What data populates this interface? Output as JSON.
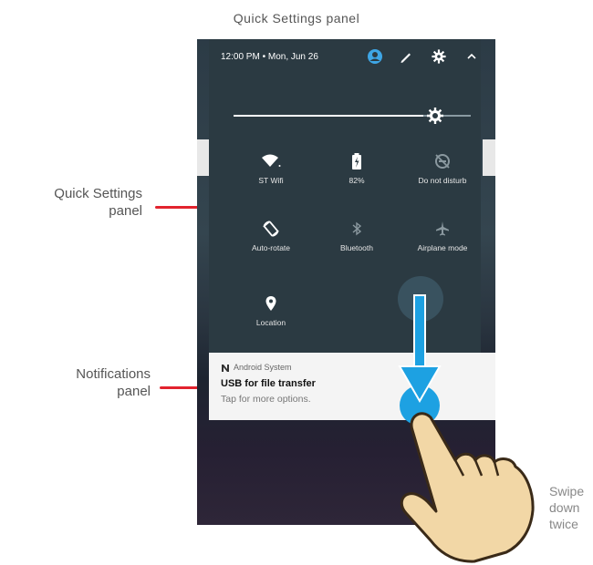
{
  "caption_top": "Quick Settings panel",
  "labels": {
    "quick_settings_line1": "Quick Settings",
    "quick_settings_line2": "panel",
    "notifications_line1": "Notifications",
    "notifications_line2": "panel",
    "swipe_line1": "Swipe",
    "swipe_line2": "down",
    "swipe_line3": "twice"
  },
  "status_bar": {
    "time_date": "12:00 PM • Mon, Jun 26",
    "icons": [
      "account-icon",
      "edit-icon",
      "gear-icon",
      "chevron-up-icon"
    ]
  },
  "brightness": {
    "level": 0.8
  },
  "tiles": [
    {
      "label": "ST Wifi",
      "icon": "wifi-icon"
    },
    {
      "label": "82%",
      "icon": "battery-icon"
    },
    {
      "label": "Do not disturb",
      "icon": "do-not-disturb-icon"
    },
    {
      "label": "Auto-rotate",
      "icon": "auto-rotate-icon"
    },
    {
      "label": "Bluetooth",
      "icon": "bluetooth-icon"
    },
    {
      "label": "Airplane mode",
      "icon": "airplane-icon"
    },
    {
      "label": "Location",
      "icon": "location-icon"
    }
  ],
  "notification": {
    "app": "Android System",
    "title": "USB for file transfer",
    "body": "Tap for more options."
  },
  "colors": {
    "accent_red": "#e2232e",
    "arrow_blue": "#1da1e2",
    "panel_bg": "#2b3a42",
    "hand_fill": "#f2d7a6"
  }
}
